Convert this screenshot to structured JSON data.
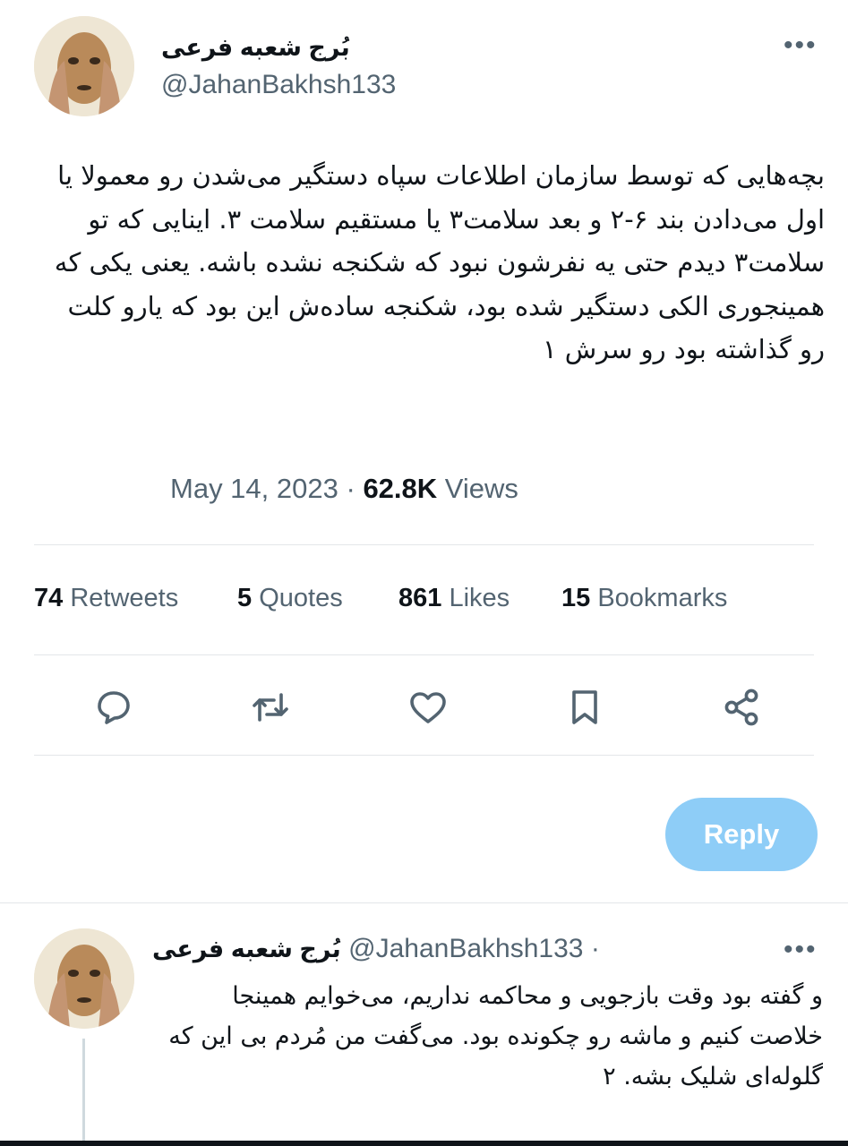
{
  "tweet": {
    "author_name": "بُرج شعبه فرعی",
    "author_handle": "@JahanBakhsh133",
    "more_label": "•••",
    "text": "بچه‌هایی که توسط سازمان اطلاعات سپاه دستگیر می‌شدن رو معمولا یا اول می‌دادن بند ۶-۲ و بعد سلامت۳ یا مستقیم سلامت ۳. اینایی که تو سلامت۳ دیدم حتی یه نفرشون نبود که شکنجه نشده باشه. یعنی یکی که همینجوری الکی دستگیر شده بود، شکنجه ساده‌ش این بود که یارو کلت رو گذاشته بود رو سرش ۱",
    "date": "May 14, 2023",
    "separator": "·",
    "views_count": "62.8K",
    "views_label": "Views"
  },
  "stats": {
    "retweets_count": "74",
    "retweets_label": "Retweets",
    "quotes_count": "5",
    "quotes_label": "Quotes",
    "likes_count": "861",
    "likes_label": "Likes",
    "bookmarks_count": "15",
    "bookmarks_label": "Bookmarks"
  },
  "actions": [
    "comment-icon",
    "retweet-icon",
    "heart-icon",
    "bookmark-icon",
    "share-icon"
  ],
  "reply_button_label": "Reply",
  "reply_tweet": {
    "author_name": "بُرج شعبه فرعی",
    "author_handle": "@JahanBakhsh133",
    "separator": "·",
    "more_label": "•••",
    "text": "و گفته بود وقت بازجویی و محاکمه نداریم، می‌خوایم همینجا خلاصت کنیم و ماشه رو چکونده بود. می‌گفت من مُردم بی این که گلوله‌ای شلیک بشه. ۲"
  },
  "colors": {
    "accent_disabled": "#8ecdf7",
    "text": "#0f1419",
    "secondary": "#536471",
    "divider": "#e3e6e9"
  }
}
